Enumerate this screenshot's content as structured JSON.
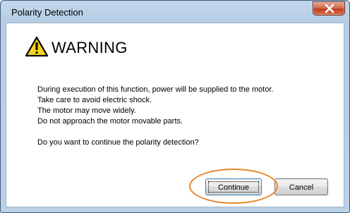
{
  "window": {
    "title": "Polarity Detection"
  },
  "dialog": {
    "heading": "WARNING",
    "lines": [
      "During execution of this function, power will be supplied to the motor.",
      "Take care to avoid electric shock.",
      "The motor may move widely.",
      "Do not approach the motor movable parts."
    ],
    "question": "Do you want to continue the polarity detection?",
    "buttons": {
      "continue": "Continue",
      "cancel": "Cancel"
    }
  },
  "icons": {
    "warning": "warning-triangle-icon",
    "close": "close-icon"
  },
  "colors": {
    "highlight": "#e8862a",
    "warning_yellow": "#f7d21c"
  }
}
